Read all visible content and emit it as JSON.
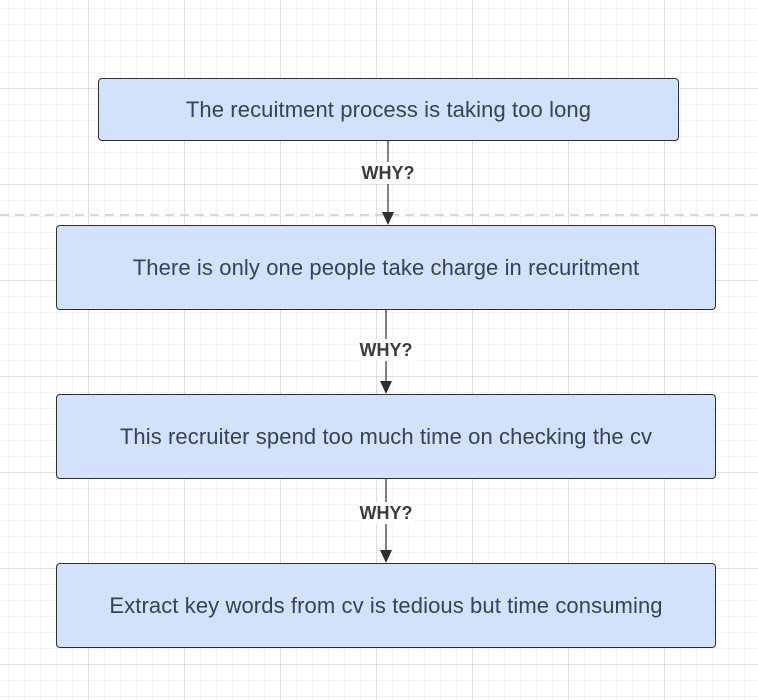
{
  "colors": {
    "box_fill": "#d2e2fc",
    "box_border": "#2f2f2f",
    "text": "#3a4150",
    "connector": "#2f2f2f",
    "separator": "#cccccc"
  },
  "nodes": [
    {
      "text": "The recuitment process is taking too long"
    },
    {
      "text": "There is only one people take charge in recuritment"
    },
    {
      "text": "This recruiter spend too much time on checking the cv"
    },
    {
      "text": "Extract key words from cv is tedious but time consuming"
    }
  ],
  "edges": [
    {
      "label": "WHY?"
    },
    {
      "label": "WHY?"
    },
    {
      "label": "WHY?"
    }
  ]
}
